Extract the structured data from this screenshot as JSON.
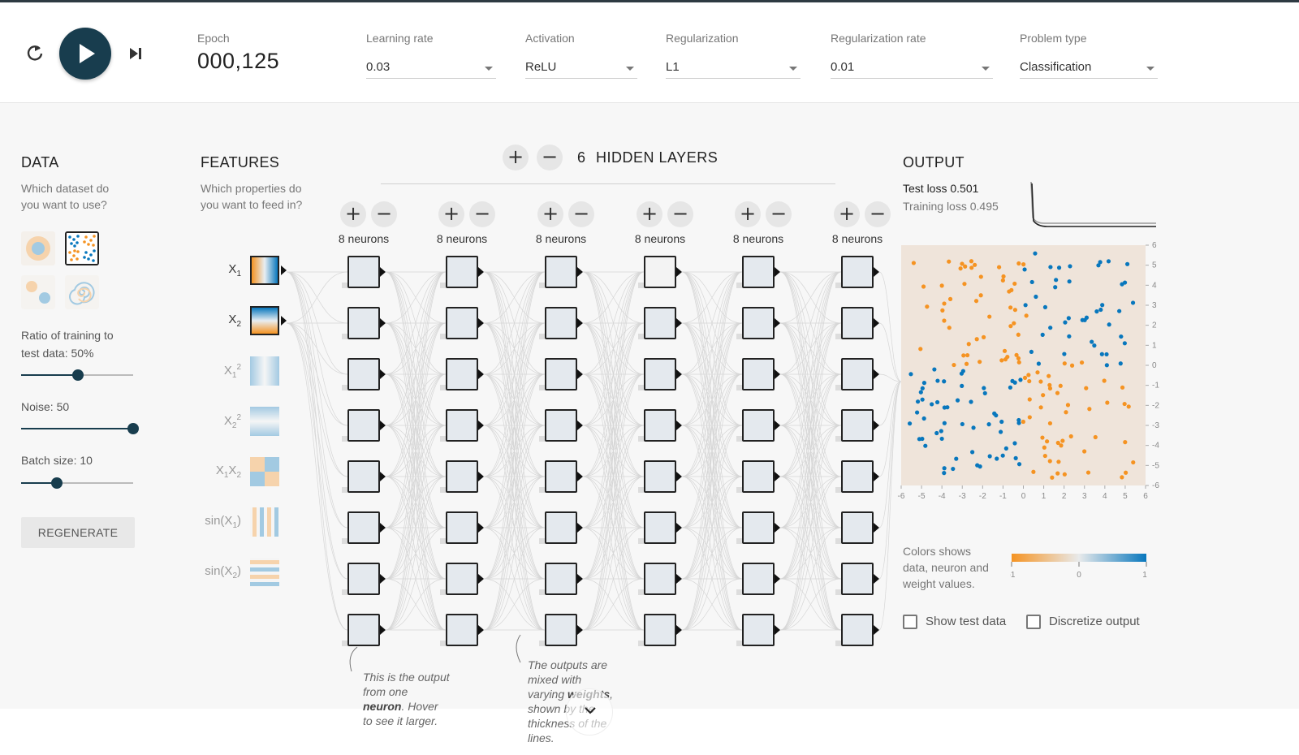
{
  "controls": {
    "epoch_label": "Epoch",
    "epoch_value": "000,125",
    "learning_rate": {
      "label": "Learning rate",
      "value": "0.03"
    },
    "activation": {
      "label": "Activation",
      "value": "ReLU"
    },
    "regularization": {
      "label": "Regularization",
      "value": "L1"
    },
    "regularization_rate": {
      "label": "Regularization rate",
      "value": "0.01"
    },
    "problem_type": {
      "label": "Problem type",
      "value": "Classification"
    }
  },
  "data_panel": {
    "title": "DATA",
    "subtitle_1": "Which dataset do",
    "subtitle_2": "you want to use?",
    "ratio_label_1": "Ratio of training to",
    "ratio_label_2": "test data:  50%",
    "ratio_value": 50,
    "noise_label": "Noise:  50",
    "noise_value": 50,
    "batch_label": "Batch size:  10",
    "batch_value": 10,
    "regenerate": "REGENERATE"
  },
  "features_panel": {
    "title": "FEATURES",
    "subtitle_1": "Which properties do",
    "subtitle_2": "you want to feed in?",
    "features": [
      {
        "base": "X",
        "sub": "1",
        "sup": "",
        "active": true
      },
      {
        "base": "X",
        "sub": "2",
        "sup": "",
        "active": true
      },
      {
        "base": "X",
        "sub": "1",
        "sup": "2",
        "active": false
      },
      {
        "base": "X",
        "sub": "2",
        "sup": "2",
        "active": false
      },
      {
        "base": "X",
        "sub": "1",
        "sup": "",
        "base2": "X",
        "sub2": "2",
        "active": false
      },
      {
        "base": "sin(X",
        "sub": "1",
        "tail": ")",
        "active": false
      },
      {
        "base": "sin(X",
        "sub": "2",
        "tail": ")",
        "active": false
      }
    ]
  },
  "network": {
    "hidden_layers_count": "6",
    "hidden_layers_label": "HIDDEN LAYERS",
    "layers": [
      {
        "neurons": "8 neurons"
      },
      {
        "neurons": "8 neurons"
      },
      {
        "neurons": "8 neurons"
      },
      {
        "neurons": "8 neurons"
      },
      {
        "neurons": "8 neurons"
      },
      {
        "neurons": "8 neurons"
      }
    ],
    "annotation_neuron_1": "This is the output",
    "annotation_neuron_2": "from one",
    "annotation_neuron_3b": "neuron",
    "annotation_neuron_3": ". Hover",
    "annotation_neuron_4": "to see it larger.",
    "annotation_weights_1": "The outputs are",
    "annotation_weights_2": "mixed with",
    "annotation_weights_3": "varying ",
    "annotation_weights_3b": "weights",
    "annotation_weights_3c": ",",
    "annotation_weights_4": "shown by the",
    "annotation_weights_5": "thickness of the",
    "annotation_weights_6": "lines."
  },
  "output_panel": {
    "title": "OUTPUT",
    "test_loss_label": "Test loss",
    "test_loss_value": "0.501",
    "training_loss_label": "Training loss",
    "training_loss_value": "0.495",
    "axis_ticks": [
      "-6",
      "-5",
      "-4",
      "-3",
      "-2",
      "-1",
      "0",
      "1",
      "2",
      "3",
      "4",
      "5",
      "6"
    ],
    "legend_1": "Colors shows",
    "legend_2": "data, neuron and",
    "legend_3": "weight values.",
    "legend_min": "-1",
    "legend_mid": "0",
    "legend_max": "1",
    "show_test_data": "Show test data",
    "discretize_output": "Discretize output"
  },
  "colors": {
    "positive": "#0877bd",
    "negative": "#f59322",
    "dark": "#183d4e",
    "plot_bg": "#efe4da"
  }
}
